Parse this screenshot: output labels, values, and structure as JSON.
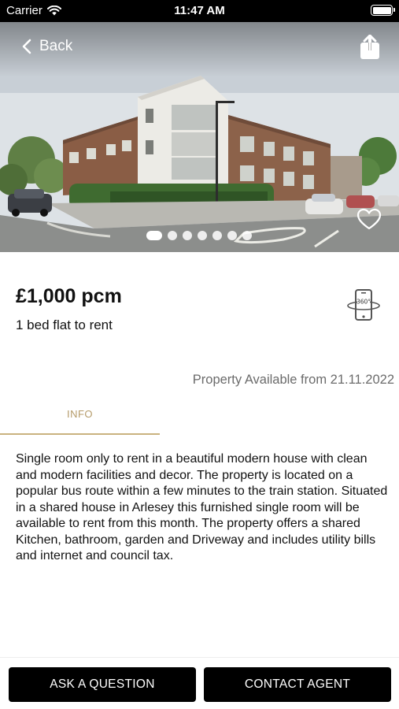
{
  "status_bar": {
    "carrier": "Carrier",
    "time": "11:47 AM",
    "battery_level": 1.0
  },
  "header": {
    "back_label": "Back",
    "back_icon": "chevron-left-icon",
    "share_icon": "share-icon",
    "favorite_icon": "heart-icon"
  },
  "gallery": {
    "photo_count": 7,
    "active_index": 0
  },
  "listing": {
    "price": "£1,000 pcm",
    "type": "1 bed flat to rent",
    "vr_badge": "360°",
    "availability": "Property Available from 21.11.2022"
  },
  "tabs": [
    {
      "label": "INFO",
      "active": true
    }
  ],
  "description": "Single room only to rent in a beautiful modern house with clean and modern facilities and decor. The property is located on a popular bus route within a few minutes to the train station. Situated in a shared house in Arlesey this furnished single room will be available to rent from this month. The property offers a shared Kitchen, bathroom, garden and Driveway and includes utility bills and internet and council tax.",
  "actions": {
    "ask_label": "ASK A QUESTION",
    "contact_label": "CONTACT AGENT"
  },
  "colors": {
    "accent": "#b59b6a",
    "button_bg": "#000000",
    "muted_text": "#6b6b6b"
  }
}
